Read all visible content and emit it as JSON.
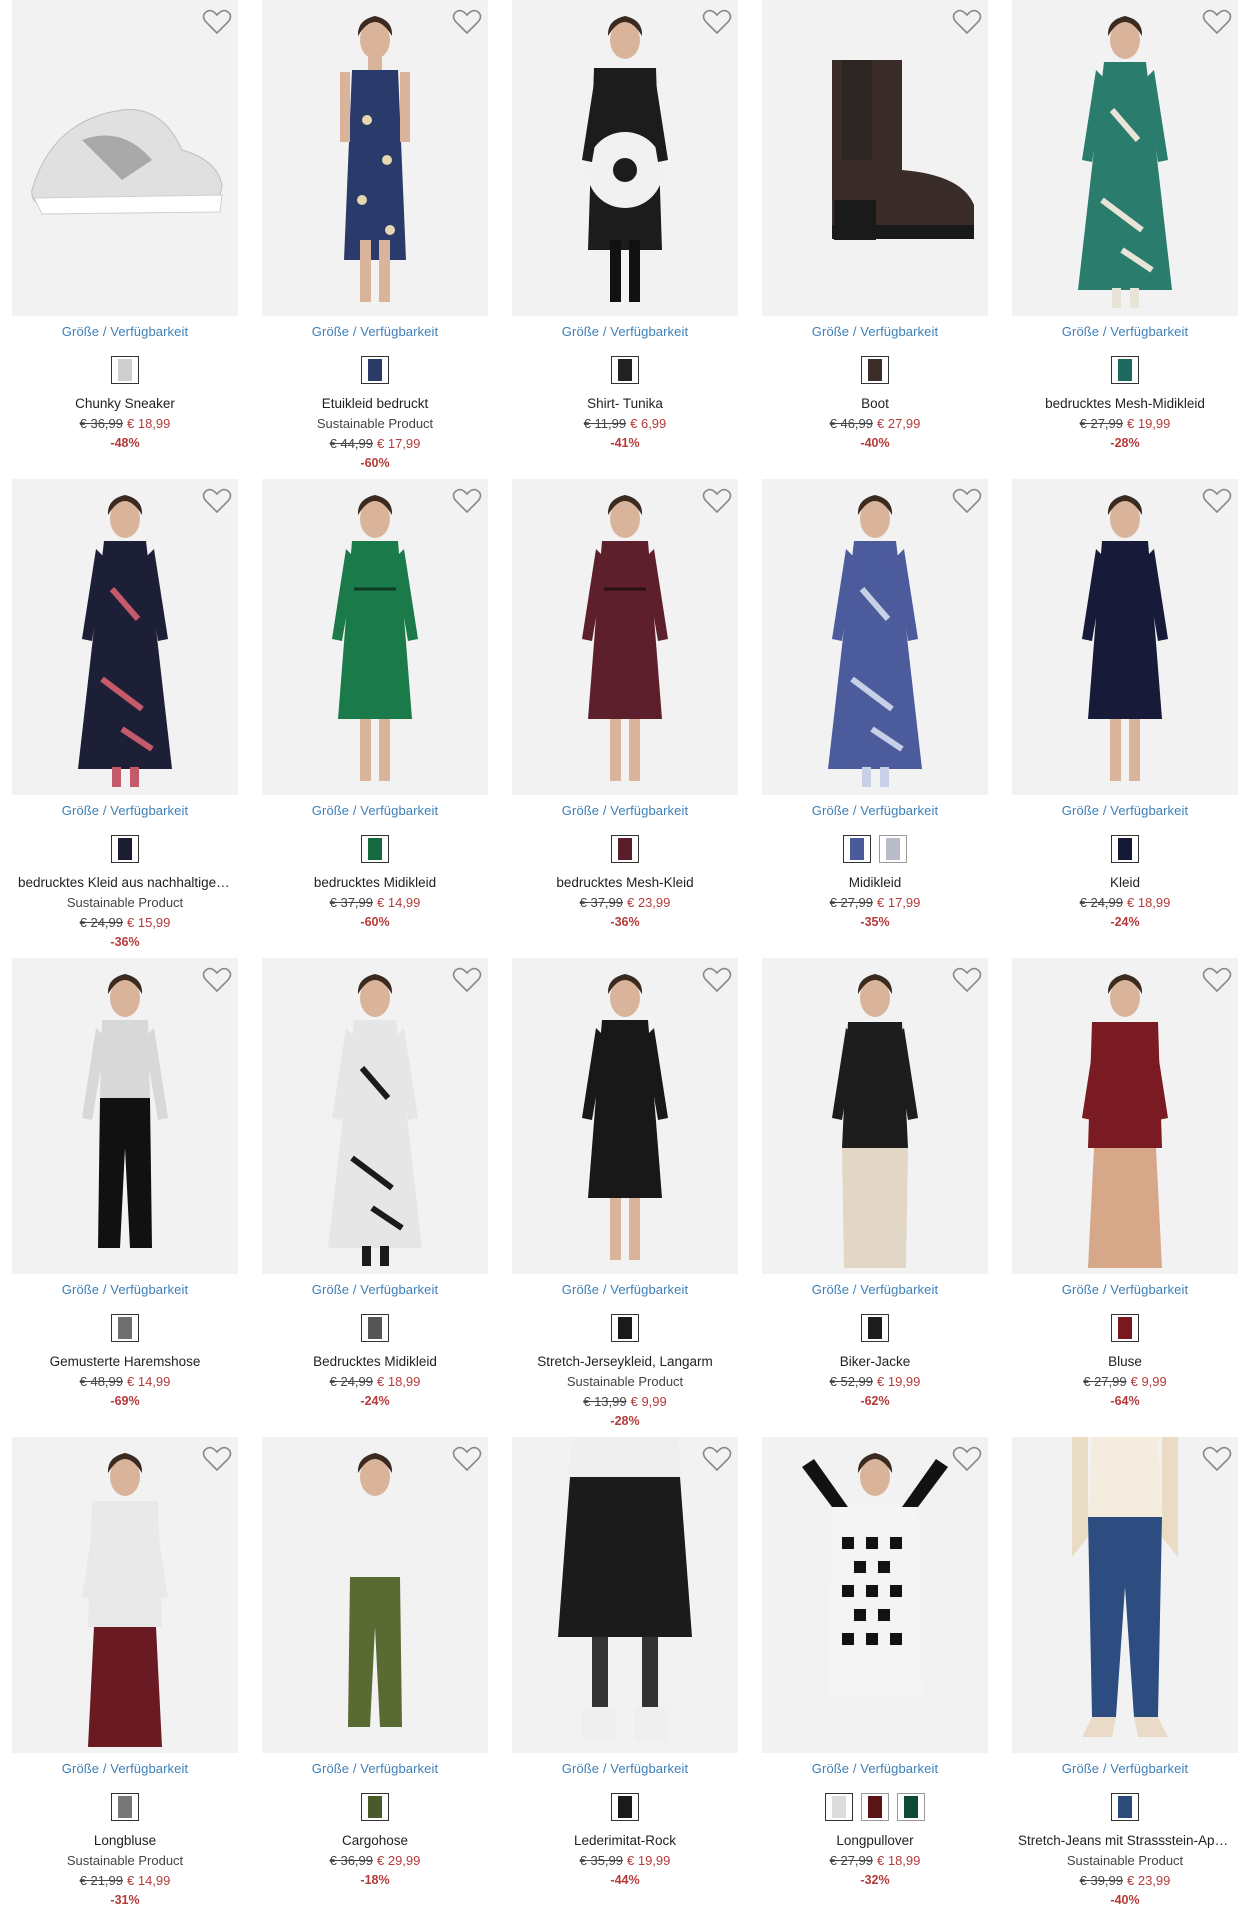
{
  "availability_label": "Größe / Verfügbarkeit",
  "colors": {
    "link": "#3d7fb8",
    "sale": "#b53a3a",
    "image_bg": "#f2f2f2"
  },
  "products": [
    {
      "name": "Chunky Sneaker",
      "sub": "",
      "old": "€ 36,99",
      "new": "€ 18,99",
      "disc": "-48%",
      "swatches": [
        "#cfcfcf"
      ],
      "figure": "sneaker",
      "c1": "#e0e0e0",
      "c2": "#a9a9a9"
    },
    {
      "name": "Etuikleid bedruckt",
      "sub": "Sustainable Product",
      "old": "€ 44,99",
      "new": "€ 17,99",
      "disc": "-60%",
      "swatches": [
        "#2c3b66"
      ],
      "figure": "dress",
      "c1": "#2a3a6a",
      "c2": "#e7d7b0"
    },
    {
      "name": "Shirt- Tunika",
      "sub": "",
      "old": "€ 11,99",
      "new": "€ 6,99",
      "disc": "-41%",
      "swatches": [
        "#222222"
      ],
      "figure": "tunic",
      "c1": "#1c1c1c",
      "c2": "#f1f1f1"
    },
    {
      "name": "Boot",
      "sub": "",
      "old": "€ 46,99",
      "new": "€ 27,99",
      "disc": "-40%",
      "swatches": [
        "#3a2d2a"
      ],
      "figure": "boot",
      "c1": "#3a2c29",
      "c2": "#1a1a1a"
    },
    {
      "name": "bedrucktes Mesh-Midikleid",
      "sub": "",
      "old": "€ 27,99",
      "new": "€ 19,99",
      "disc": "-28%",
      "swatches": [
        "#1e6a5e"
      ],
      "figure": "longdress",
      "c1": "#2a7d6c",
      "c2": "#e8e4d8"
    },
    {
      "name": "bedrucktes Kleid aus nachhaltiger ...",
      "sub": "Sustainable Product",
      "old": "€ 24,99",
      "new": "€ 15,99",
      "disc": "-36%",
      "swatches": [
        "#1b1e33"
      ],
      "figure": "longdress",
      "c1": "#1c1f36",
      "c2": "#c45a6a"
    },
    {
      "name": "bedrucktes Midikleid",
      "sub": "",
      "old": "€ 37,99",
      "new": "€ 14,99",
      "disc": "-60%",
      "swatches": [
        "#156b3f"
      ],
      "figure": "midi",
      "c1": "#1a7a4a",
      "c2": "#0f3b25"
    },
    {
      "name": "bedrucktes Mesh-Kleid",
      "sub": "",
      "old": "€ 37,99",
      "new": "€ 23,99",
      "disc": "-36%",
      "swatches": [
        "#5a1e2a"
      ],
      "figure": "midi",
      "c1": "#5e1f2c",
      "c2": "#2a1016"
    },
    {
      "name": "Midikleid",
      "sub": "",
      "old": "€ 27,99",
      "new": "€ 17,99",
      "disc": "-35%",
      "swatches": [
        "#4a5a9a",
        "#b8bcc8"
      ],
      "figure": "longdress",
      "c1": "#4c5b9c",
      "c2": "#c8d0e8"
    },
    {
      "name": "Kleid",
      "sub": "",
      "old": "€ 24,99",
      "new": "€ 18,99",
      "disc": "-24%",
      "swatches": [
        "#151935"
      ],
      "figure": "midi",
      "c1": "#171a38",
      "c2": "#171a38"
    },
    {
      "name": "Gemusterte Haremshose",
      "sub": "",
      "old": "€ 48,99",
      "new": "€ 14,99",
      "disc": "-69%",
      "swatches": [
        "#6f6f6f"
      ],
      "figure": "pants",
      "c1": "#111111",
      "c2": "#d8d8d8"
    },
    {
      "name": "Bedrucktes Midikleid",
      "sub": "",
      "old": "€ 24,99",
      "new": "€ 18,99",
      "disc": "-24%",
      "swatches": [
        "#555555"
      ],
      "figure": "longdress",
      "c1": "#e6e6e6",
      "c2": "#1b1b1b"
    },
    {
      "name": "Stretch-Jerseykleid, Langarm",
      "sub": "Sustainable Product",
      "old": "€ 13,99",
      "new": "€ 9,99",
      "disc": "-28%",
      "swatches": [
        "#1a1a1a"
      ],
      "figure": "midi",
      "c1": "#181818",
      "c2": "#181818"
    },
    {
      "name": "Biker-Jacke",
      "sub": "",
      "old": "€ 52,99",
      "new": "€ 19,99",
      "disc": "-62%",
      "swatches": [
        "#1d1d1d"
      ],
      "figure": "jacket",
      "c1": "#1d1d1d",
      "c2": "#e2d6c6"
    },
    {
      "name": "Bluse",
      "sub": "",
      "old": "€ 27,99",
      "new": "€ 9,99",
      "disc": "-64%",
      "swatches": [
        "#7a1820"
      ],
      "figure": "blouse",
      "c1": "#7a1a22",
      "c2": "#d7a789"
    },
    {
      "name": "Longbluse",
      "sub": "Sustainable Product",
      "old": "€ 21,99",
      "new": "€ 14,99",
      "disc": "-31%",
      "swatches": [
        "#777777"
      ],
      "figure": "blouse",
      "c1": "#e9e9e9",
      "c2": "#6a1a22"
    },
    {
      "name": "Cargohose",
      "sub": "",
      "old": "€ 36,99",
      "new": "€ 29,99",
      "disc": "-18%",
      "swatches": [
        "#4a5a2a"
      ],
      "figure": "pants",
      "c1": "#5a6a33",
      "c2": "#f2f2f2"
    },
    {
      "name": "Lederimitat-Rock",
      "sub": "",
      "old": "€ 35,99",
      "new": "€ 19,99",
      "disc": "-44%",
      "swatches": [
        "#1a1a1a"
      ],
      "figure": "skirt",
      "c1": "#1b1b1b",
      "c2": "#efefef"
    },
    {
      "name": "Longpullover",
      "sub": "",
      "old": "€ 27,99",
      "new": "€ 18,99",
      "disc": "-32%",
      "swatches": [
        "#dcdcdc",
        "#5a1418",
        "#0e4a34"
      ],
      "figure": "sweater",
      "c1": "#121212",
      "c2": "#f4f4f4"
    },
    {
      "name": "Stretch-Jeans mit Strassstein-Appli...",
      "sub": "Sustainable Product",
      "old": "€ 39,99",
      "new": "€ 23,99",
      "disc": "-40%",
      "swatches": [
        "#2c4a7a"
      ],
      "figure": "jeans",
      "c1": "#2d4d80",
      "c2": "#f3ecdf"
    }
  ]
}
